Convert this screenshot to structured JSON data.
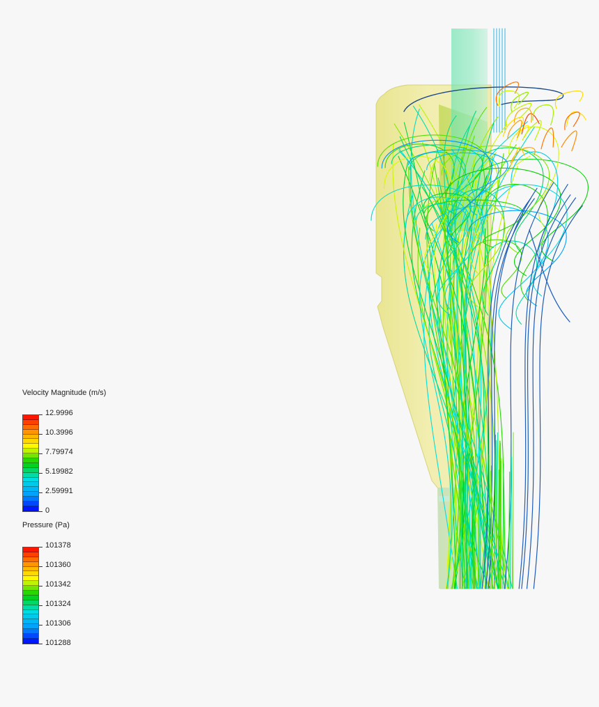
{
  "legends": [
    {
      "title": "Velocity Magnitude (m/s)",
      "labels": [
        "12.9996",
        "10.3996",
        "7.79974",
        "5.19982",
        "2.59991",
        "0"
      ]
    },
    {
      "title": "Pressure (Pa)",
      "labels": [
        "101378",
        "101360",
        "101342",
        "101324",
        "101306",
        "101288"
      ]
    }
  ],
  "colors": {
    "background": "#f7f7f7",
    "body": "#eaea9a",
    "vortex_finder": "#6ee0a8",
    "scale": [
      "#0000ff",
      "#00a0ff",
      "#00e0e0",
      "#00d000",
      "#ffff00",
      "#ff9000",
      "#ff0000"
    ]
  }
}
